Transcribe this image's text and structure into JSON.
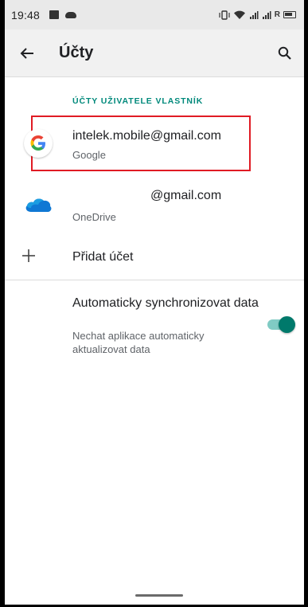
{
  "status_bar": {
    "time": "19:48",
    "right_text": "ᵢₗ ᴿ"
  },
  "app_bar": {
    "title": "Účty"
  },
  "section": {
    "header": "ÚČTY UŽIVATELE VLASTNÍK"
  },
  "accounts": [
    {
      "email": "intelek.mobile@gmail.com",
      "provider": "Google",
      "icon": "google-icon"
    },
    {
      "email": "@gmail.com",
      "provider": "OneDrive",
      "icon": "onedrive-icon"
    }
  ],
  "add_account": {
    "label": "Přidat účet",
    "icon": "plus-icon"
  },
  "sync": {
    "title": "Automaticky synchronizovat data",
    "subtitle": "Nechat aplikace automaticky aktualizovat data",
    "enabled": true
  },
  "colors": {
    "accent": "#00897b",
    "highlight_border": "#e01b24"
  }
}
